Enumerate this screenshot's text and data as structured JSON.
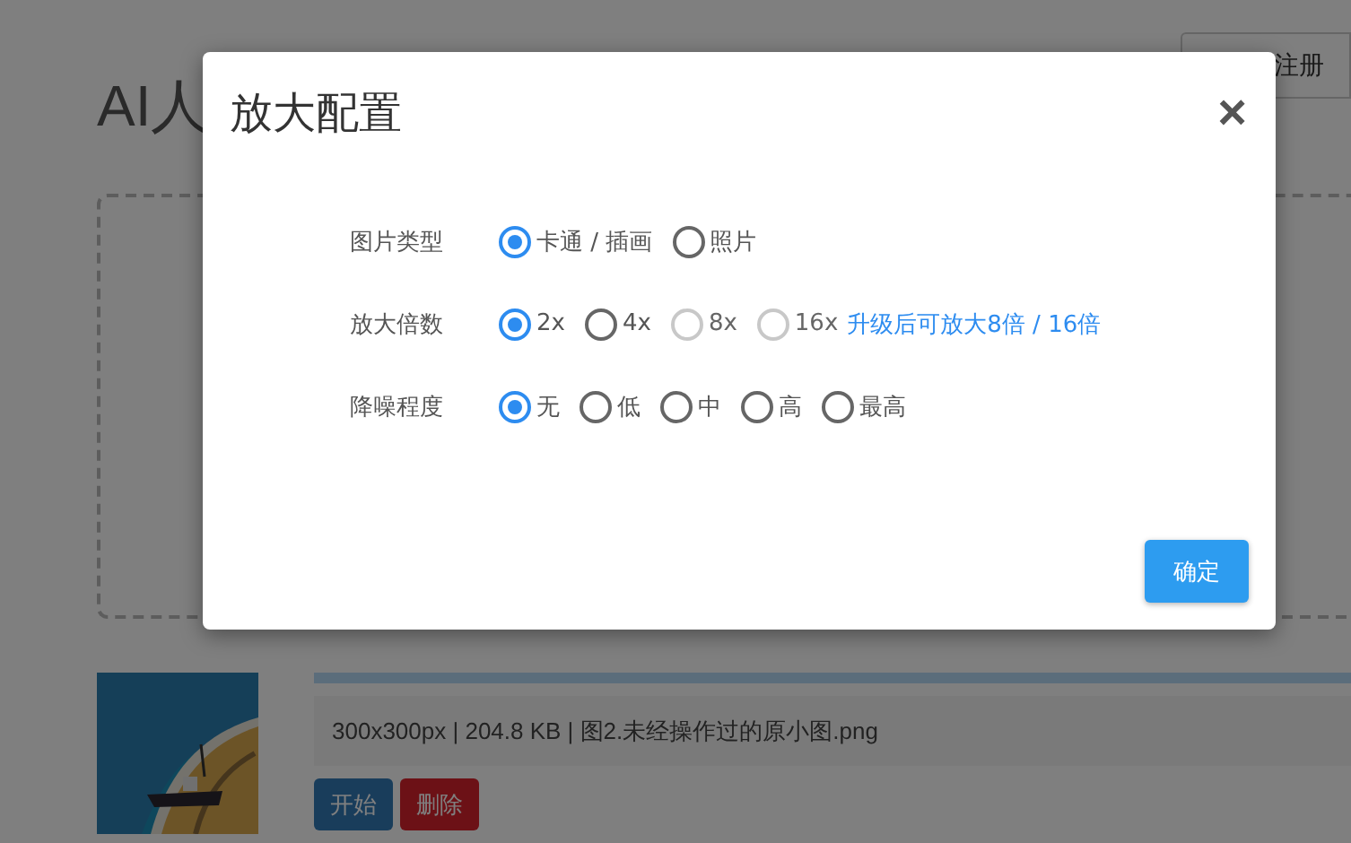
{
  "page": {
    "title": "AI人",
    "register_button": "注册",
    "upload": {
      "progress": {
        "level": 1
      },
      "file_info": "300x300px | 204.8 KB | 图2.未经操作过的原小图.png",
      "buttons": [
        {
          "label": "开始",
          "kind": "primary"
        },
        {
          "label": "删除",
          "kind": "danger"
        }
      ]
    }
  },
  "dialog": {
    "title": "放大配置",
    "close": "×",
    "groups": [
      {
        "label": "图片类型",
        "options": [
          {
            "label": "卡通 / 插画",
            "selected": true,
            "disabled": false
          },
          {
            "label": "照片",
            "selected": false,
            "disabled": false
          }
        ]
      },
      {
        "label": "放大倍数",
        "options": [
          {
            "label": "2x",
            "selected": true,
            "disabled": false
          },
          {
            "label": "4x",
            "selected": false,
            "disabled": false
          },
          {
            "label": "8x",
            "selected": false,
            "disabled": true
          },
          {
            "label": "16x",
            "selected": false,
            "disabled": true
          }
        ],
        "note": "升级后可放大8倍 / 16倍"
      },
      {
        "label": "降噪程度",
        "options": [
          {
            "label": "无",
            "selected": true,
            "disabled": false
          },
          {
            "label": "低",
            "selected": false,
            "disabled": false
          },
          {
            "label": "中",
            "selected": false,
            "disabled": false
          },
          {
            "label": "高",
            "selected": false,
            "disabled": false
          },
          {
            "label": "最高",
            "selected": false,
            "disabled": false
          }
        ]
      }
    ],
    "confirm": "确定"
  }
}
